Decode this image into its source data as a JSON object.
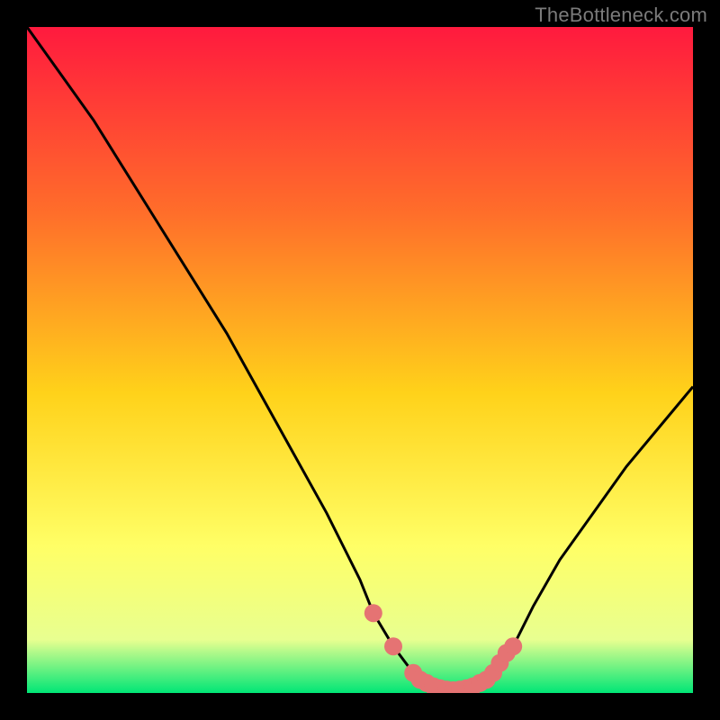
{
  "watermark": "TheBottleneck.com",
  "colors": {
    "background": "#000000",
    "gradient_top": "#ff1a3e",
    "gradient_mid1": "#ff6e2a",
    "gradient_mid2": "#ffd21a",
    "gradient_mid3": "#ffff66",
    "gradient_mid4": "#e8ff90",
    "gradient_bottom": "#00e676",
    "curve": "#000000",
    "dot": "#e57373"
  },
  "chart_data": {
    "type": "line",
    "title": "",
    "xlabel": "",
    "ylabel": "",
    "xlim": [
      0,
      100
    ],
    "ylim": [
      0,
      100
    ],
    "series": [
      {
        "name": "bottleneck-curve",
        "x": [
          0,
          5,
          10,
          15,
          20,
          25,
          30,
          35,
          40,
          45,
          50,
          52,
          55,
          58,
          61,
          64,
          67,
          70,
          73,
          76,
          80,
          85,
          90,
          95,
          100
        ],
        "y": [
          100,
          93,
          86,
          78,
          70,
          62,
          54,
          45,
          36,
          27,
          17,
          12,
          7,
          3,
          1,
          0,
          1,
          3,
          7,
          13,
          20,
          27,
          34,
          40,
          46
        ]
      }
    ],
    "markers": {
      "name": "highlight-dots",
      "x": [
        52,
        55,
        58,
        59,
        60,
        61,
        62,
        63,
        64,
        65,
        66,
        67,
        68,
        69,
        70,
        71,
        72,
        73
      ],
      "y": [
        12,
        7,
        3,
        2,
        1.5,
        1,
        0.7,
        0.5,
        0.4,
        0.5,
        0.7,
        1,
        1.5,
        2,
        3,
        4.5,
        6,
        7
      ]
    }
  }
}
